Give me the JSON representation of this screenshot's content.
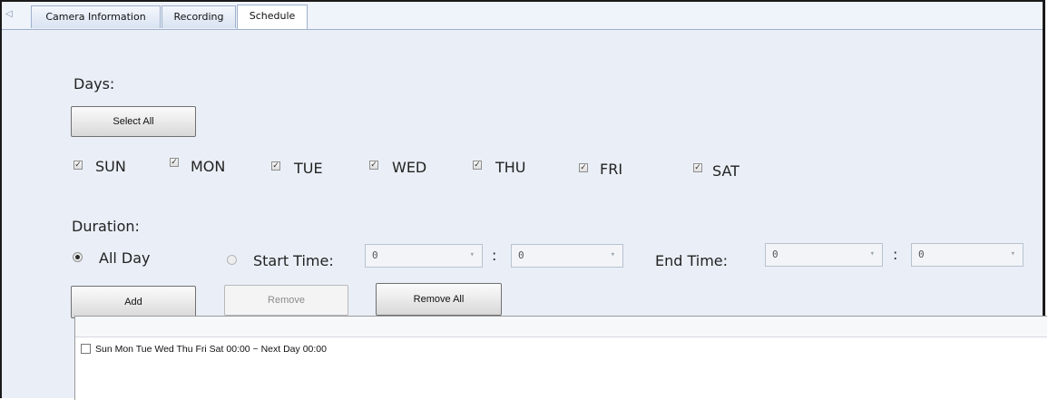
{
  "tabs": [
    {
      "label": "Camera Information",
      "active": false
    },
    {
      "label": "Recording",
      "active": false
    },
    {
      "label": "Schedule",
      "active": true
    }
  ],
  "days_section": {
    "title": "Days:",
    "select_all_label": "Select All",
    "days": [
      {
        "label": "SUN",
        "checked": true
      },
      {
        "label": "MON",
        "checked": true
      },
      {
        "label": "TUE",
        "checked": true
      },
      {
        "label": "WED",
        "checked": true
      },
      {
        "label": "THU",
        "checked": true
      },
      {
        "label": "FRI",
        "checked": true
      },
      {
        "label": "SAT",
        "checked": true
      }
    ]
  },
  "duration_section": {
    "title": "Duration:",
    "all_day_label": "All Day",
    "all_day_selected": true,
    "start_time_label": "Start Time:",
    "start_time_selected": false,
    "start_hour": "0",
    "start_minute": "0",
    "end_time_label": "End Time:",
    "end_hour": "0",
    "end_minute": "0",
    "colon": ":"
  },
  "buttons": {
    "add": "Add",
    "remove": "Remove",
    "remove_all": "Remove All"
  },
  "schedule_list": {
    "items": [
      {
        "text": "Sun Mon Tue Wed Thu Fri Sat 00:00 ~ Next Day 00:00",
        "checked": false
      }
    ]
  },
  "icons": {
    "check_mark": "✓",
    "dropdown_arrow": "▾",
    "scroll_left": "◁"
  }
}
